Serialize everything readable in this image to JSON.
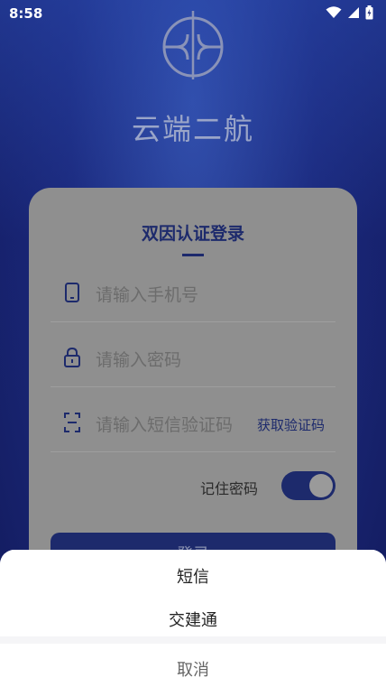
{
  "status_bar": {
    "time": "8:58",
    "icons": [
      "wifi-icon",
      "signal-icon",
      "battery-icon"
    ]
  },
  "app": {
    "title": "云端二航"
  },
  "login_card": {
    "title": "双因认证登录",
    "phone": {
      "placeholder": "请输入手机号",
      "icon": "phone-icon"
    },
    "password": {
      "placeholder": "请输入密码",
      "icon": "lock-icon"
    },
    "code": {
      "placeholder": "请输入短信验证码",
      "icon": "scan-icon",
      "get_code_label": "获取验证码"
    },
    "remember": {
      "label": "记住密码",
      "enabled": true
    },
    "login_label": "登录"
  },
  "action_sheet": {
    "options": [
      "短信",
      "交建通"
    ],
    "cancel_label": "取消"
  },
  "colors": {
    "primary": "#1d2a6c",
    "background": "#1c2a78",
    "card": "#8f8f8f"
  }
}
